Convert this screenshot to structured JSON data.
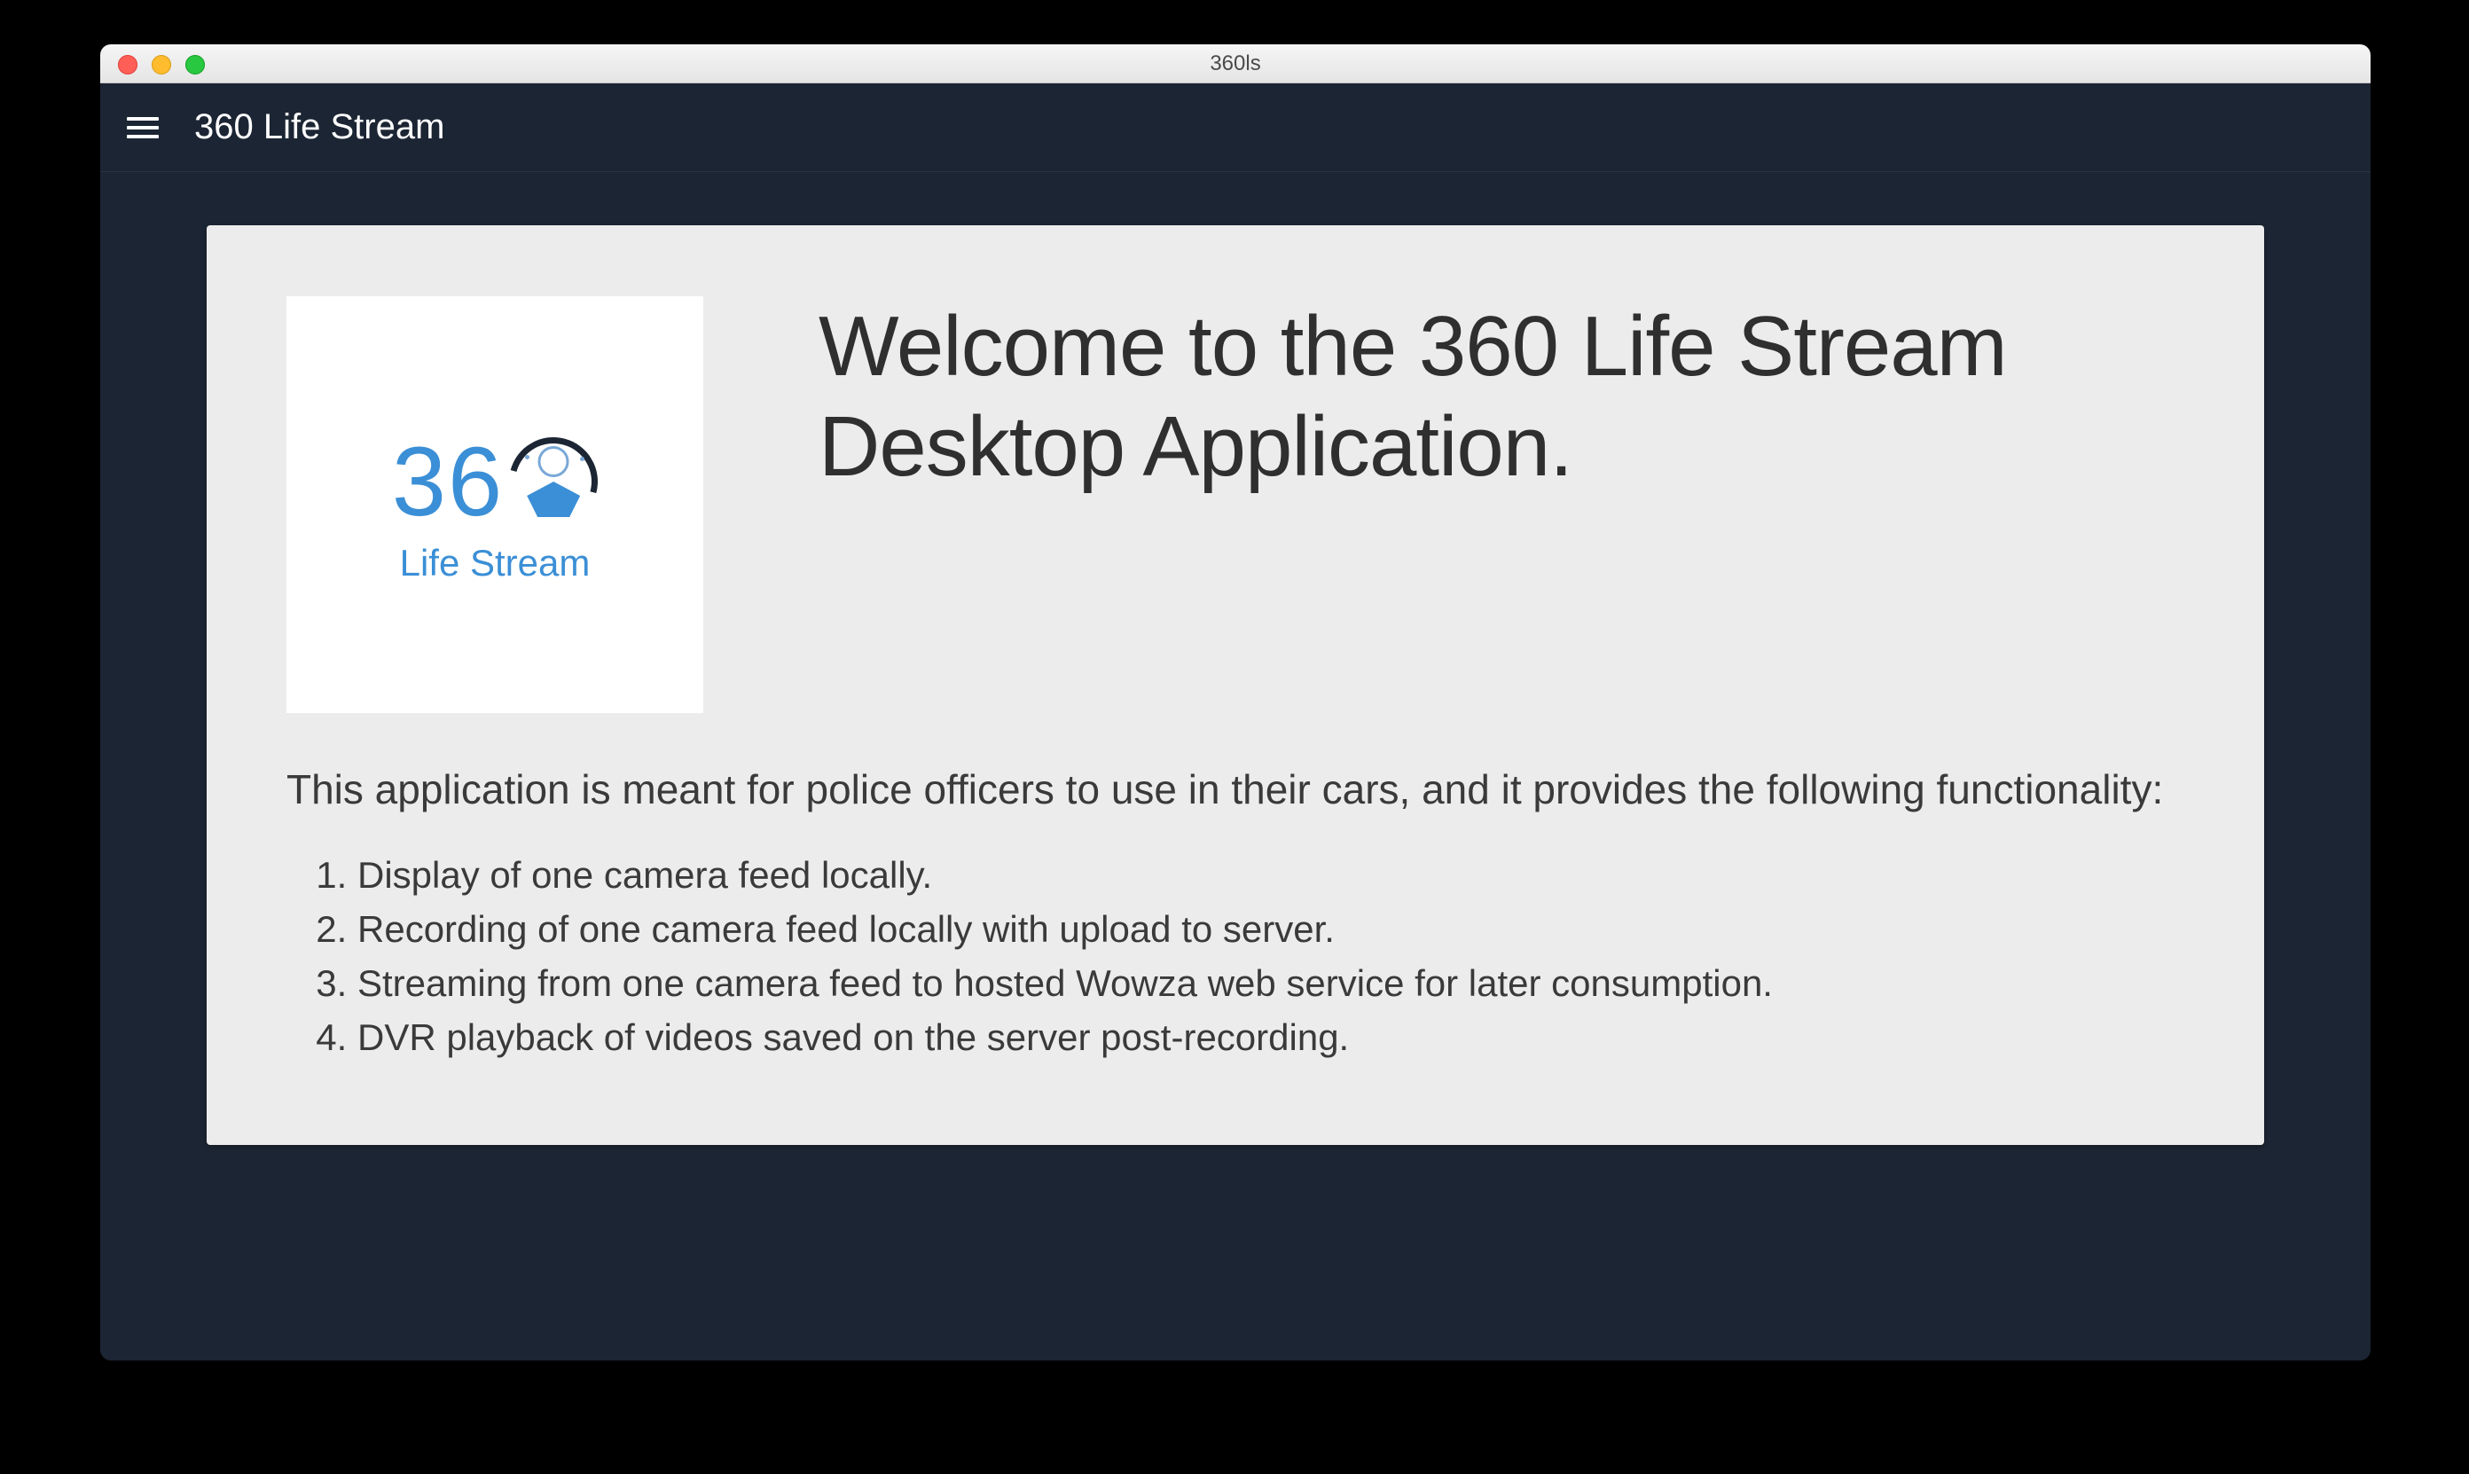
{
  "window": {
    "title": "360ls"
  },
  "header": {
    "menu_icon": "hamburger-menu-icon",
    "app_title": "360 Life Stream"
  },
  "logo": {
    "numeric": "36",
    "subtext": "Life Stream"
  },
  "content": {
    "heading": "Welcome to the 360 Life Stream Desktop Application.",
    "intro": "This application is meant for police officers to use in their cars, and it provides the following functionality:",
    "features": [
      "Display of one camera feed locally.",
      "Recording of one camera feed locally with upload to server.",
      "Streaming from one camera feed to hosted Wowza web service for later consumption.",
      "DVR playback of videos saved on the server post-recording."
    ]
  },
  "colors": {
    "app_bg": "#1c2533",
    "card_bg": "#ececec",
    "brand_blue": "#3b8fd6",
    "text_dark": "#2f2f2f"
  }
}
